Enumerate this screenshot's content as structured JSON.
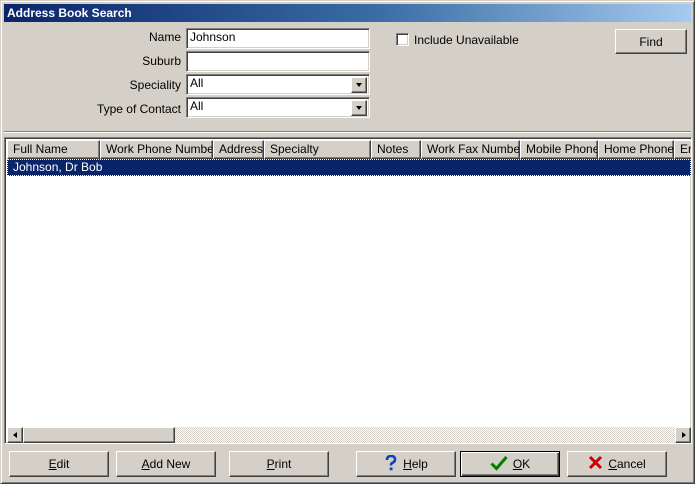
{
  "window": {
    "title": "Address Book Search"
  },
  "form": {
    "name_label": "Name",
    "name_value": "Johnson",
    "suburb_label": "Suburb",
    "suburb_value": "",
    "speciality_label": "Speciality",
    "speciality_value": "All",
    "contact_type_label": "Type of Contact",
    "contact_type_value": "All",
    "include_unavailable_label": "Include Unavailable",
    "include_unavailable_checked": false,
    "find_label": "Find"
  },
  "table": {
    "columns": [
      "Full Name",
      "Work Phone Number",
      "Address",
      "Specialty",
      "Notes",
      "Work Fax Number",
      "Mobile Phone",
      "Home Phone",
      "Em"
    ],
    "rows": [
      {
        "full_name": "Johnson, Dr Bob",
        "selected": true
      }
    ]
  },
  "buttons": {
    "edit": {
      "accel": "E",
      "rest": "dit"
    },
    "add_new": {
      "accel": "A",
      "rest": "dd New"
    },
    "print": {
      "accel": "P",
      "rest": "rint"
    },
    "help": {
      "accel": "H",
      "rest": "elp"
    },
    "ok": {
      "accel": "O",
      "rest": "K"
    },
    "cancel": {
      "accel": "C",
      "rest": "ancel"
    }
  },
  "colors": {
    "title_bar": "#0a246a",
    "selection": "#0a246a",
    "face": "#d4d0c8",
    "ok_icon": "#008000",
    "cancel_icon": "#cc0000",
    "help_icon": "#1040c0"
  }
}
